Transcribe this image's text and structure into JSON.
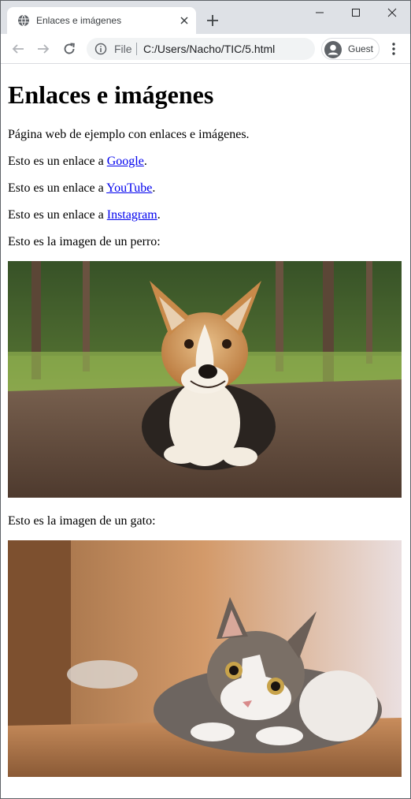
{
  "browser": {
    "tab_title": "Enlaces e imágenes",
    "url_scheme": "File",
    "url": "C:/Users/Nacho/TIC/5.html",
    "profile_label": "Guest"
  },
  "page": {
    "heading": "Enlaces e imágenes",
    "intro": "Página web de ejemplo con enlaces e imágenes.",
    "links": [
      {
        "prefix": "Esto es un enlace a ",
        "text": "Google",
        "suffix": "."
      },
      {
        "prefix": "Esto es un enlace a ",
        "text": "YouTube",
        "suffix": "."
      },
      {
        "prefix": "Esto es un enlace a ",
        "text": "Instagram",
        "suffix": "."
      }
    ],
    "dog_caption": "Esto es la imagen de un perro:",
    "cat_caption": "Esto es la imagen de un gato:"
  },
  "colors": {
    "link": "#0000ee",
    "tabstrip": "#dee1e6",
    "omnibox": "#f1f3f4"
  }
}
